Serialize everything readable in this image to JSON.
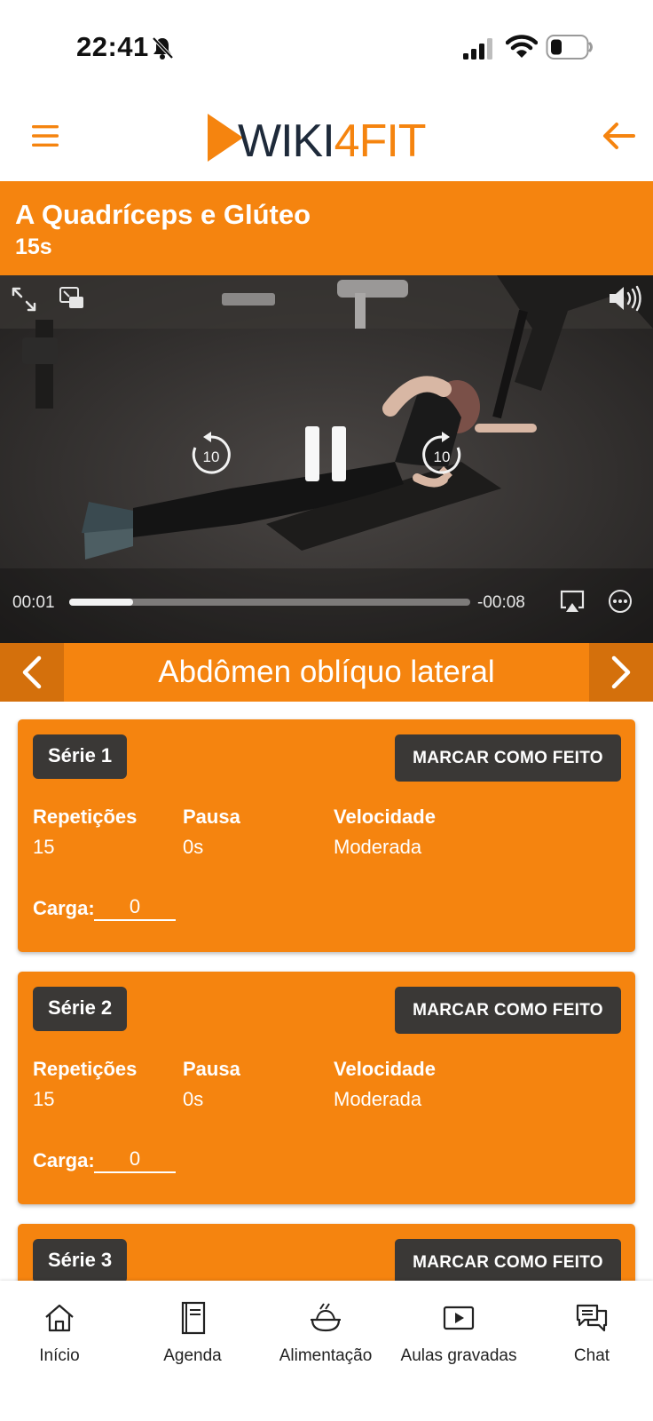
{
  "status_bar": {
    "time": "22:41",
    "icons": [
      "bell-off-icon",
      "signal-icon",
      "wifi-icon",
      "battery-icon"
    ]
  },
  "header": {
    "logo_text_1": "WIKI",
    "logo_text_2": "4",
    "logo_text_3": "FIT",
    "menu_icon": "hamburger-menu-icon",
    "back_icon": "arrow-left-icon"
  },
  "workout": {
    "title": "A Quadríceps e Glúteo",
    "duration": "15s"
  },
  "video": {
    "elapsed": "00:01",
    "remaining": "-00:08",
    "progress": 0.16,
    "skip_seconds": "10",
    "state": "playing"
  },
  "exercise": {
    "name": "Abdômen oblíquo lateral"
  },
  "series": [
    {
      "label": "Série 1",
      "done_label": "MARCAR COMO FEITO",
      "reps_label": "Repetições",
      "reps": "15",
      "pause_label": "Pausa",
      "pause": "0s",
      "speed_label": "Velocidade",
      "speed": "Moderada",
      "load_label": "Carga:",
      "load": "0"
    },
    {
      "label": "Série 2",
      "done_label": "MARCAR COMO FEITO",
      "reps_label": "Repetições",
      "reps": "15",
      "pause_label": "Pausa",
      "pause": "0s",
      "speed_label": "Velocidade",
      "speed": "Moderada",
      "load_label": "Carga:",
      "load": "0"
    },
    {
      "label": "Série 3",
      "done_label": "MARCAR COMO FEITO"
    }
  ],
  "bottom_nav": [
    {
      "label": "Início",
      "icon": "home-icon"
    },
    {
      "label": "Agenda",
      "icon": "notebook-icon"
    },
    {
      "label": "Alimentação",
      "icon": "food-bowl-icon"
    },
    {
      "label": "Aulas gravadas",
      "icon": "play-video-icon"
    },
    {
      "label": "Chat",
      "icon": "chat-icon"
    }
  ],
  "colors": {
    "brand_orange": "#f5840f",
    "dark_button": "#3a3836",
    "logo_navy": "#1e2a3a"
  }
}
